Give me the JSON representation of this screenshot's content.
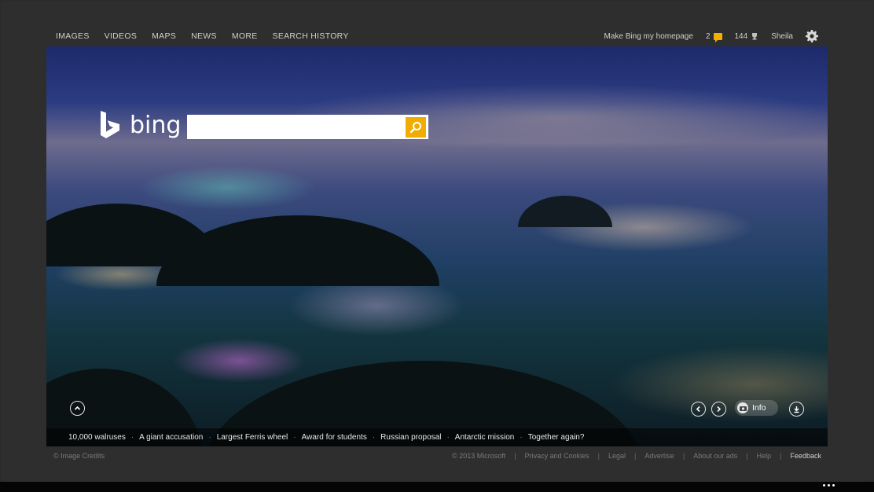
{
  "nav": {
    "items": [
      "IMAGES",
      "VIDEOS",
      "MAPS",
      "NEWS",
      "MORE",
      "SEARCH HISTORY"
    ]
  },
  "header_right": {
    "homepage_link": "Make Bing my homepage",
    "messages_count": "2",
    "rewards_count": "144",
    "user_name": "Sheila"
  },
  "brand": {
    "logo_text": "bing"
  },
  "search": {
    "value": "",
    "placeholder": ""
  },
  "hero": {
    "info_label": "Info",
    "headlines": [
      "10,000 walruses",
      "A giant accusation",
      "Largest Ferris wheel",
      "Award for students",
      "Russian proposal",
      "Antarctic mission",
      "Together again?"
    ]
  },
  "footer": {
    "image_credits": "© Image Credits",
    "copyright": "© 2013 Microsoft",
    "links": [
      "Privacy and Cookies",
      "Legal",
      "Advertise",
      "About our ads",
      "Help",
      "Feedback"
    ]
  },
  "colors": {
    "accent": "#f0ac00",
    "background": "#2e2e2e"
  }
}
